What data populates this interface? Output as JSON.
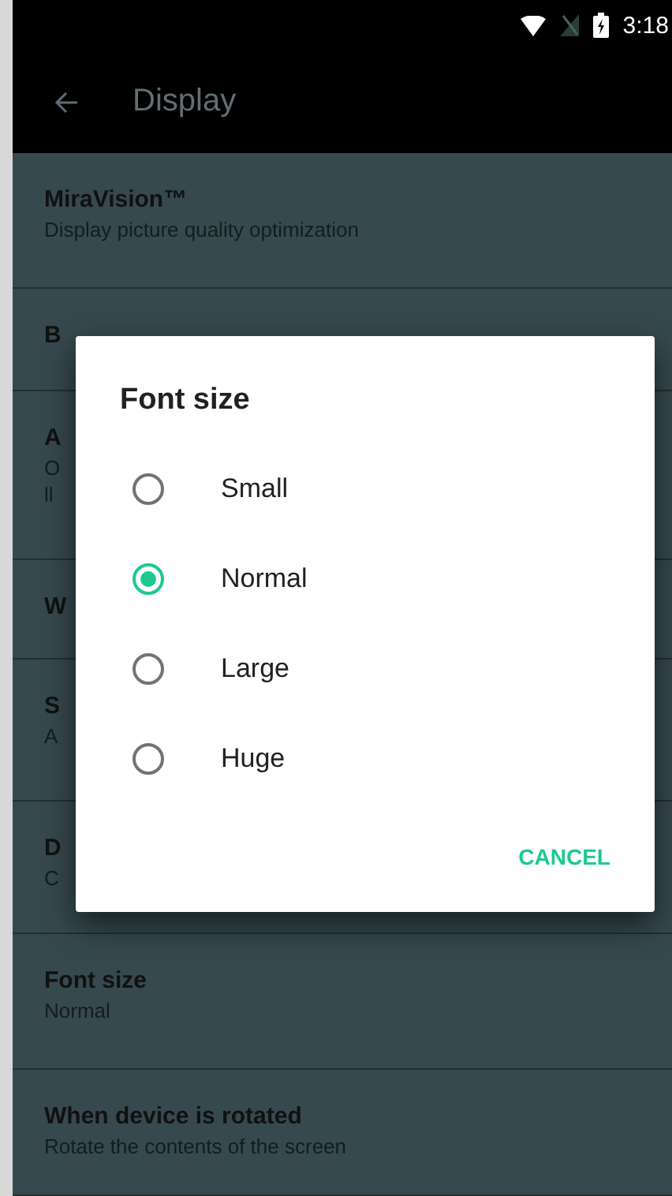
{
  "status_bar": {
    "time": "3:18"
  },
  "toolbar": {
    "title": "Display"
  },
  "settings": [
    {
      "title": "MiraVision™",
      "summary": [
        "Display picture quality optimization"
      ]
    },
    {
      "title": "B"
    },
    {
      "title": "A",
      "summary": [
        "O",
        "ll"
      ]
    },
    {
      "title": "W"
    },
    {
      "title": "S",
      "summary": [
        "A"
      ]
    },
    {
      "title": "D",
      "summary": [
        "C"
      ]
    },
    {
      "title": "Font size",
      "summary": [
        "Normal"
      ]
    },
    {
      "title": "When device is rotated",
      "summary": [
        "Rotate the contents of the screen"
      ]
    }
  ],
  "dialog": {
    "title": "Font size",
    "options": [
      {
        "label": "Small",
        "selected": false
      },
      {
        "label": "Normal",
        "selected": true
      },
      {
        "label": "Large",
        "selected": false
      },
      {
        "label": "Huge",
        "selected": false
      }
    ],
    "button": "CANCEL"
  }
}
